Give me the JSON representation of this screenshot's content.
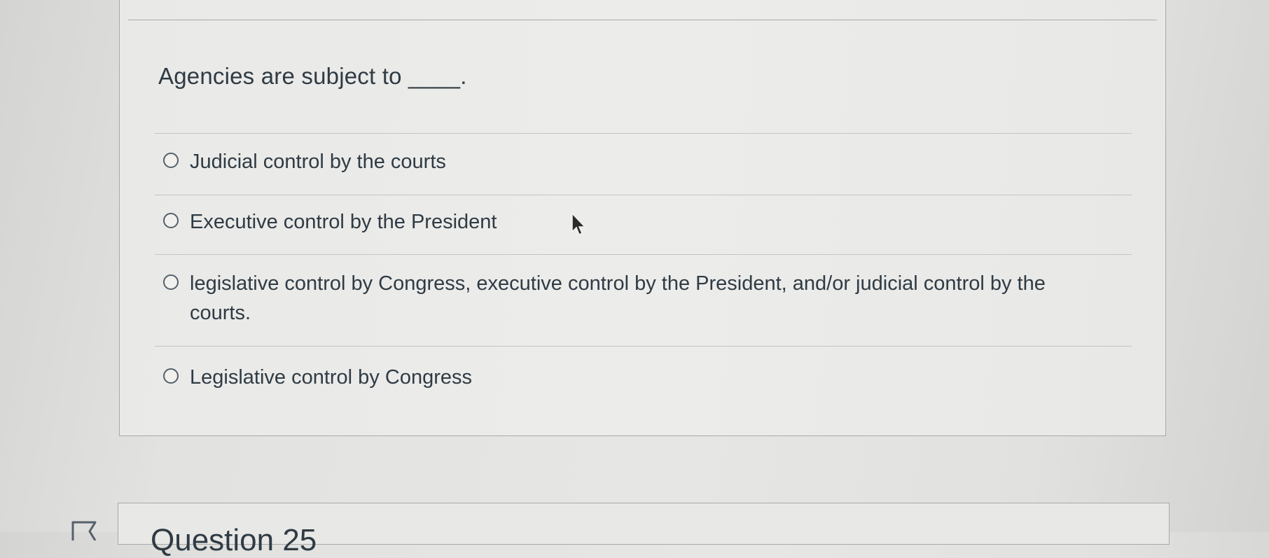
{
  "question": {
    "text": "Agencies are subject to ____.",
    "options": [
      {
        "label": "Judicial control by the courts",
        "selected": false
      },
      {
        "label": "Executive control by the President",
        "selected": false
      },
      {
        "label": "legislative control by Congress, executive control by the President, and/or judicial control by the courts.",
        "selected": false
      },
      {
        "label": "Legislative control by Congress",
        "selected": false
      }
    ]
  },
  "next_question": {
    "title": "Question 25"
  },
  "icons": {
    "cursor": "mouse-pointer-icon",
    "flag": "flag-icon",
    "radio": "radio-circle-icon"
  },
  "colors": {
    "text": "#2f3b44",
    "border": "#a9a9a7",
    "background": "#e6e6e4"
  }
}
